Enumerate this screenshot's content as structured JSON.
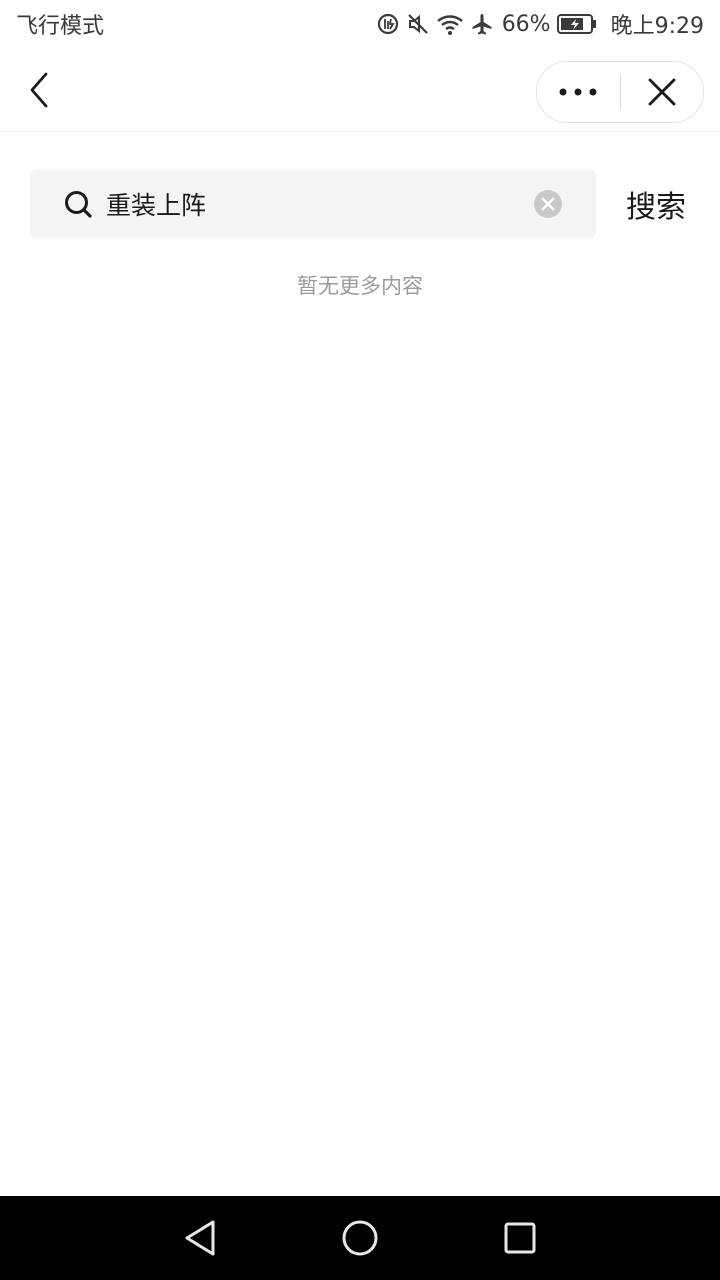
{
  "status_bar": {
    "mode_text": "飞行模式",
    "battery_percent": "66%",
    "time": "晚上9:29",
    "icons": [
      "data-saver-icon",
      "mute-icon",
      "wifi-icon",
      "airplane-icon",
      "battery-icon"
    ]
  },
  "title_bar": {
    "back_icon": "chevron-left-icon",
    "more_icon": "more-dots-icon",
    "close_icon": "close-icon"
  },
  "search": {
    "value": "重装上阵",
    "placeholder": "",
    "action_label": "搜索",
    "clear_icon": "clear-icon"
  },
  "results": {
    "empty_text": "暂无更多内容"
  },
  "nav_bar": {
    "icons": [
      "nav-back-icon",
      "nav-home-icon",
      "nav-recents-icon"
    ]
  },
  "colors": {
    "search_bg": "#f3f4f5",
    "empty_text": "#9b9b9b",
    "nav_bg": "#000000"
  }
}
